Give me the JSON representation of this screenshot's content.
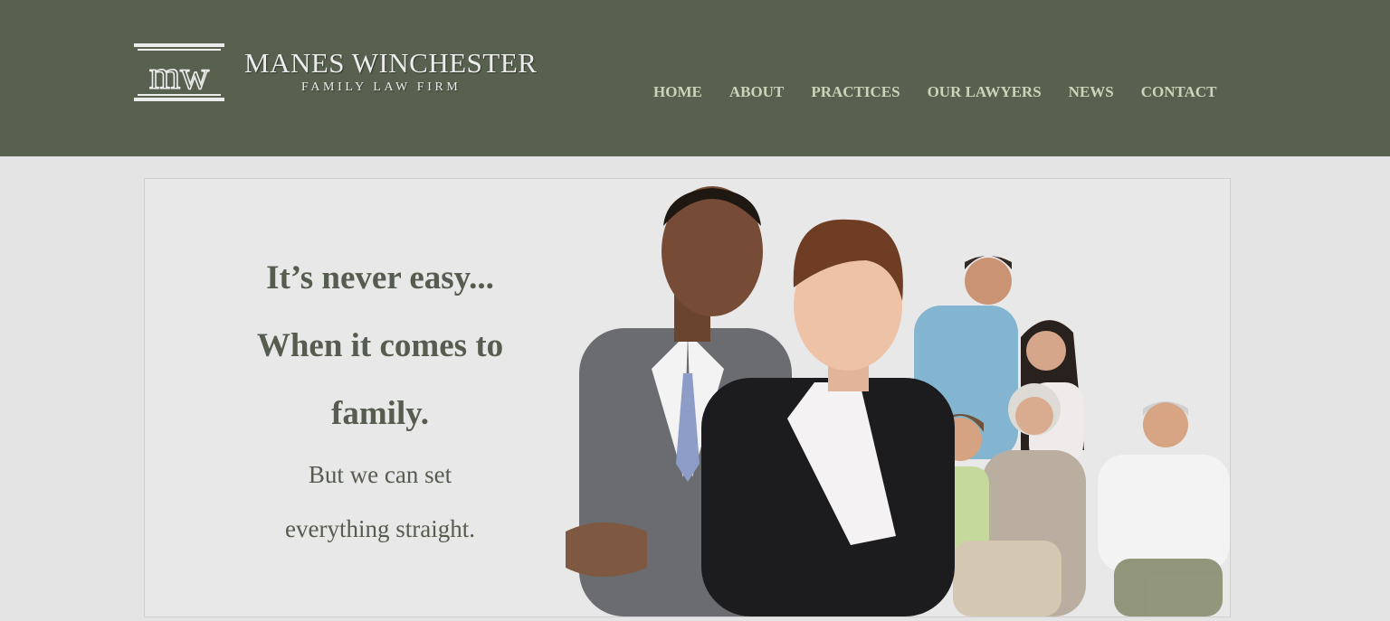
{
  "brand": {
    "monogram": "MW",
    "name": "MANES WINCHESTER",
    "subtitle": "FAMILY LAW FIRM"
  },
  "nav": {
    "items": [
      {
        "label": "HOME"
      },
      {
        "label": "ABOUT"
      },
      {
        "label": "PRACTICES"
      },
      {
        "label": "OUR LAWYERS"
      },
      {
        "label": "NEWS"
      },
      {
        "label": "CONTACT"
      }
    ]
  },
  "hero": {
    "headline_line1": "It’s never easy...",
    "headline_line2": "When it comes to",
    "headline_line3": "family.",
    "tagline_line1": "But we can set",
    "tagline_line2": "everything straight."
  },
  "colors": {
    "header_bg": "#58614f",
    "nav_text": "#c9d4b8",
    "page_bg": "#e4e4e4",
    "hero_text": "#565c4f"
  }
}
